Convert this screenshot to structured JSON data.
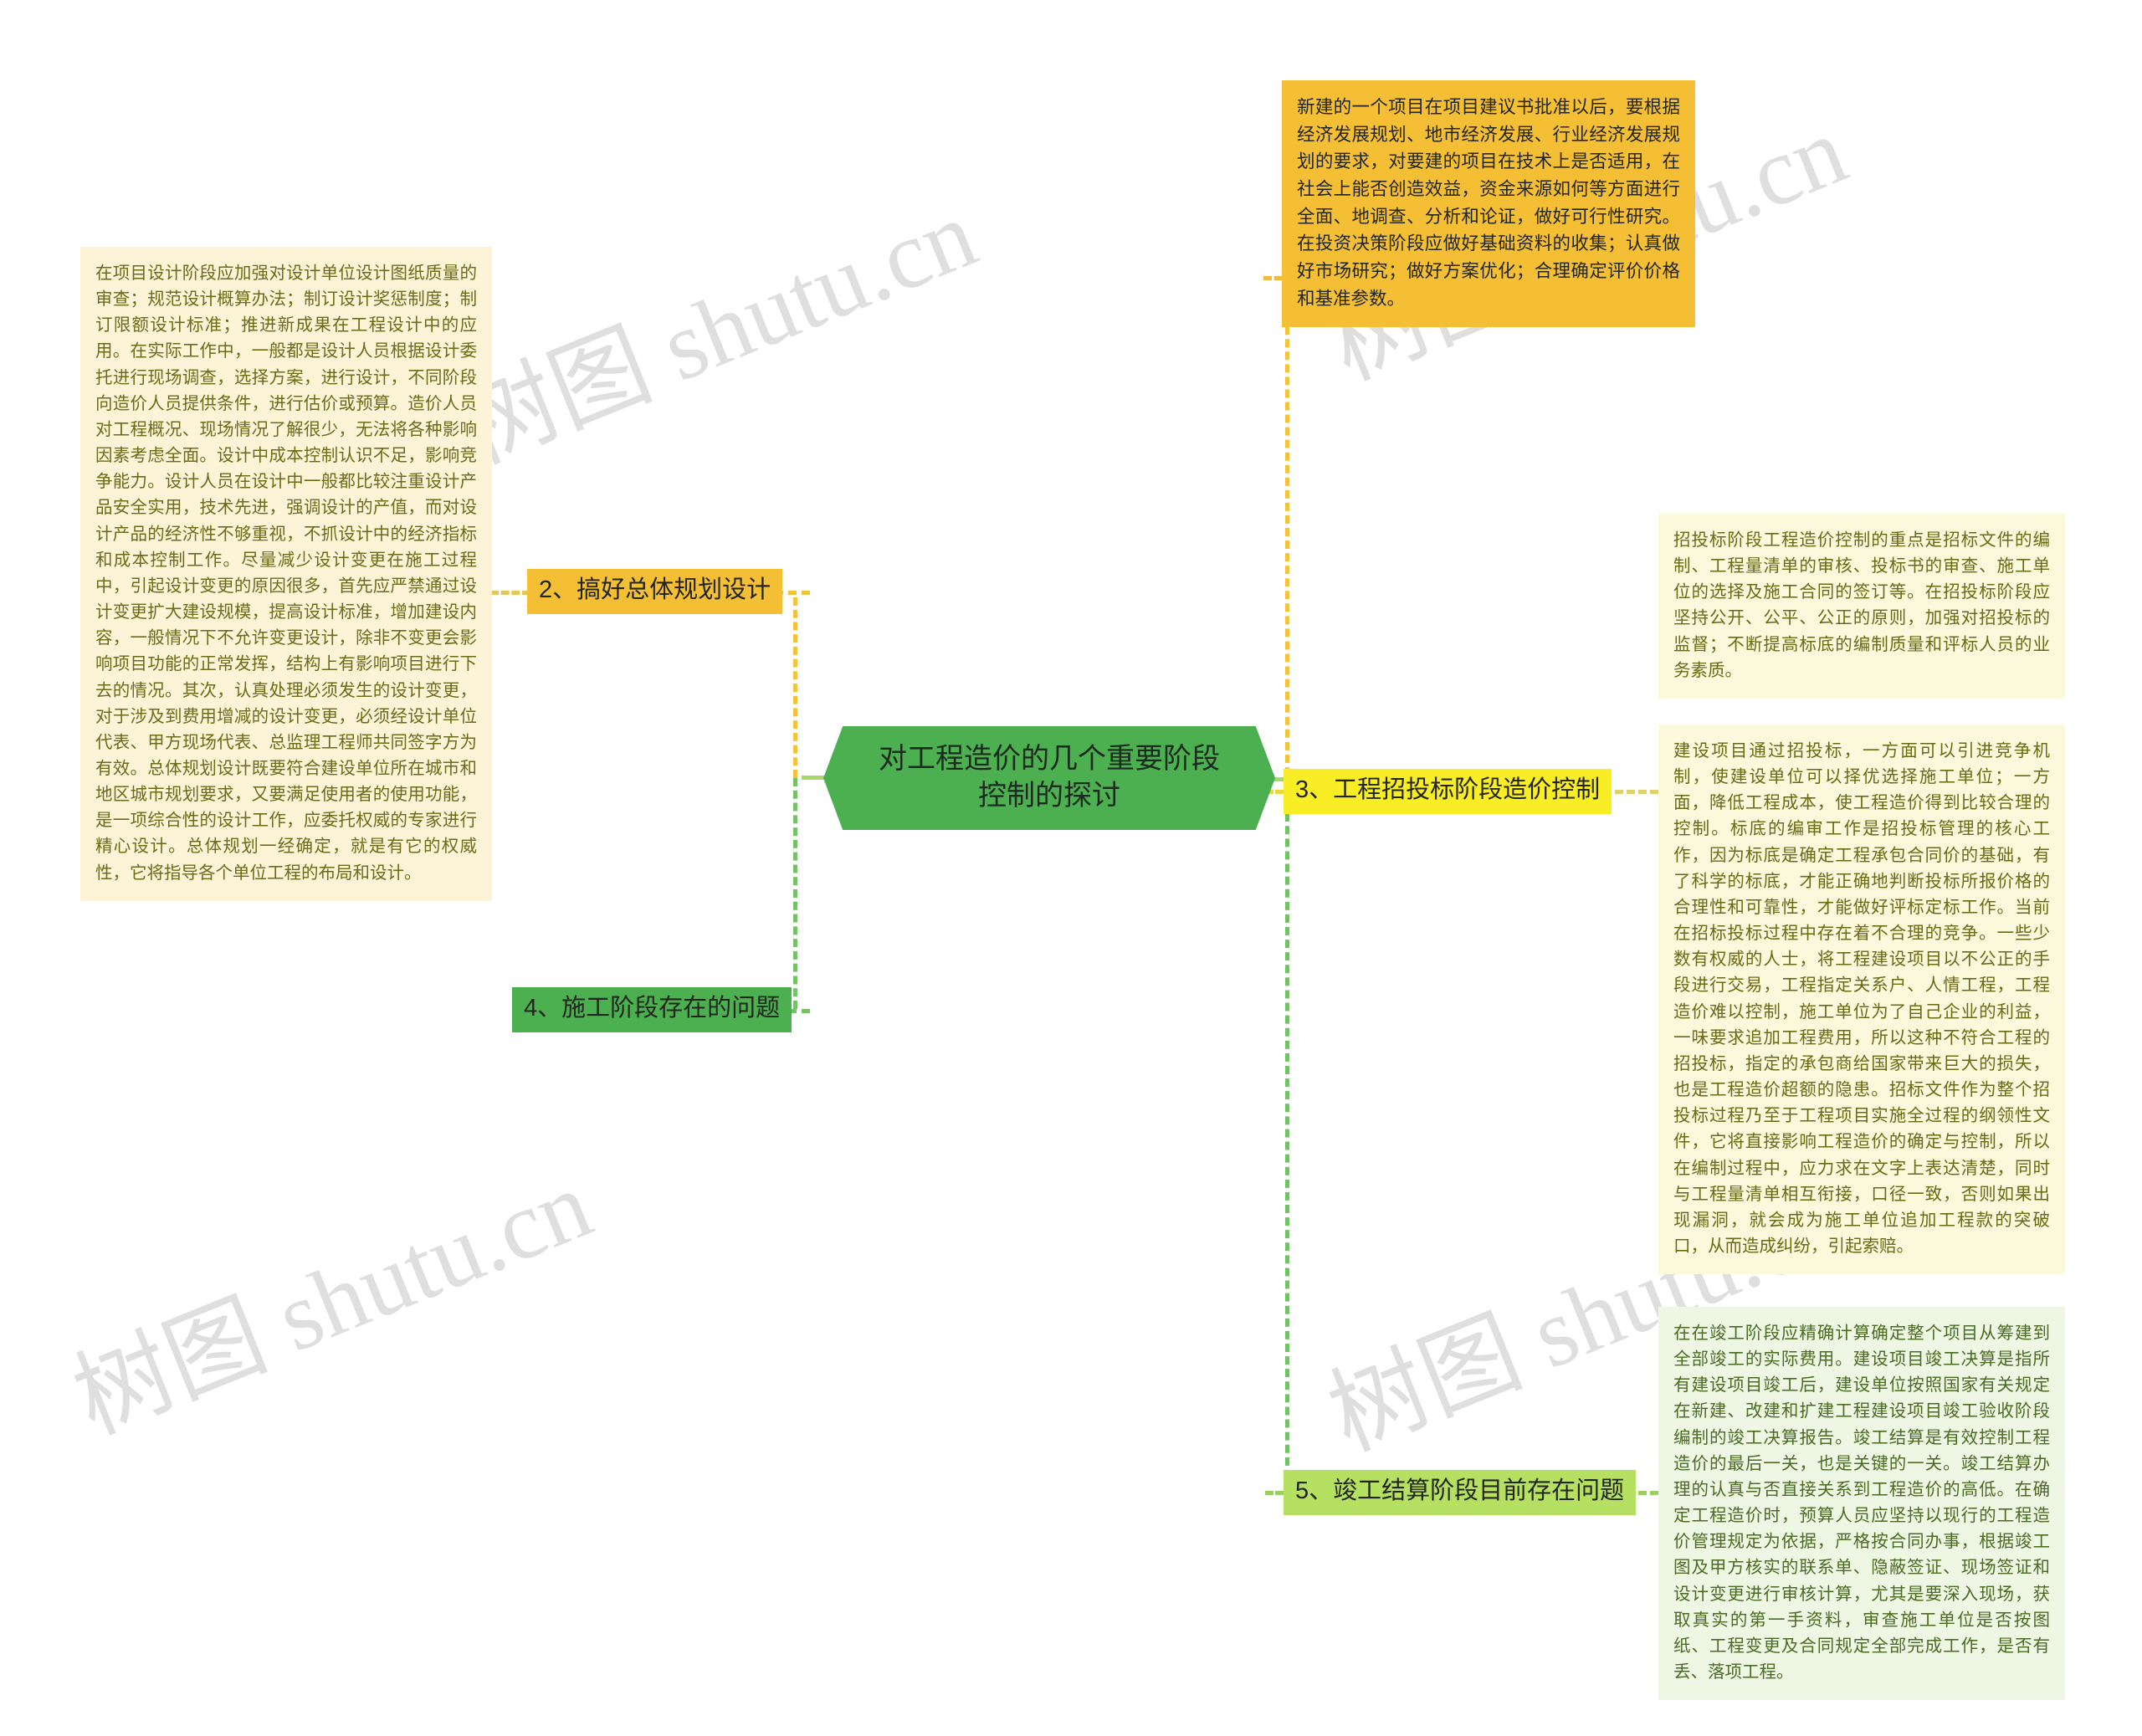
{
  "meta": {
    "watermark_text": "树图 shutu.cn",
    "colors": {
      "central": "#4caf50",
      "orange": "#f4bf34",
      "yellow": "#f9ed25",
      "green": "#4caf50",
      "light_green": "#b5e061",
      "cream": "#fdf4d8",
      "mint": "#eef7e4"
    }
  },
  "central": {
    "title": "对工程造价的几个重要阶段控制的探讨"
  },
  "branches": {
    "decision_detail": {
      "text": "新建的一个项目在项目建议书批准以后，要根据经济发展规划、地市经济发展、行业经济发展规划的要求，对要建的项目在技术上是否适用，在社会上能否创造效益，资金来源如何等方面进行全面、地调查、分析和论证，做好可行性研究。在投资决策阶段应做好基础资料的收集；认真做好市场研究；做好方案优化；合理确定评价价格和基准参数。"
    },
    "planning": {
      "label": "2、搞好总体规划设计",
      "detail": "在项目设计阶段应加强对设计单位设计图纸质量的审查；规范设计概算办法；制订设计奖惩制度；制订限额设计标准；推进新成果在工程设计中的应用。在实际工作中，一般都是设计人员根据设计委托进行现场调查，选择方案，进行设计，不同阶段向造价人员提供条件，进行估价或预算。造价人员对工程概况、现场情况了解很少，无法将各种影响因素考虑全面。设计中成本控制认识不足，影响竞争能力。设计人员在设计中一般都比较注重设计产品安全实用，技术先进，强调设计的产值，而对设计产品的经济性不够重视，不抓设计中的经济指标和成本控制工作。尽量减少设计变更在施工过程中，引起设计变更的原因很多，首先应严禁通过设计变更扩大建设规模，提高设计标准，增加建设内容，一般情况下不允许变更设计，除非不变更会影响项目功能的正常发挥，结构上有影响项目进行下去的情况。其次，认真处理必须发生的设计变更，对于涉及到费用增减的设计变更，必须经设计单位代表、甲方现场代表、总监理工程师共同签字方为有效。总体规划设计既要符合建设单位所在城市和地区城市规划要求，又要满足使用者的使用功能，是一项综合性的设计工作，应委托权威的专家进行精心设计。总体规划一经确定，就是有它的权威性，它将指导各个单位工程的布局和设计。"
    },
    "bidding": {
      "label": "3、工程招投标阶段造价控制",
      "detail_1": "招投标阶段工程造价控制的重点是招标文件的编制、工程量清单的审核、投标书的审查、施工单位的选择及施工合同的签订等。在招投标阶段应坚持公开、公平、公正的原则，加强对招投标的监督；不断提高标底的编制质量和评标人员的业务素质。",
      "detail_2": "建设项目通过招投标，一方面可以引进竞争机制，使建设单位可以择优选择施工单位；一方面，降低工程成本，使工程造价得到比较合理的控制。标底的编审工作是招投标管理的核心工作，因为标底是确定工程承包合同价的基础，有了科学的标底，才能正确地判断投标所报价格的合理性和可靠性，才能做好评标定标工作。当前在招标投标过程中存在着不合理的竞争。一些少数有权威的人士，将工程建设项目以不公正的手段进行交易，工程指定关系户、人情工程，工程造价难以控制，施工单位为了自己企业的利益，一味要求追加工程费用，所以这种不符合工程的招投标，指定的承包商给国家带来巨大的损失，也是工程造价超额的隐患。招标文件作为整个招投标过程乃至于工程项目实施全过程的纲领性文件，它将直接影响工程造价的确定与控制，所以在编制过程中，应力求在文字上表达清楚，同时与工程量清单相互衔接，口径一致，否则如果出现漏洞，就会成为施工单位追加工程款的突破口，从而造成纠纷，引起索赔。"
    },
    "construction": {
      "label": "4、施工阶段存在的问题"
    },
    "settlement": {
      "label": "5、竣工结算阶段目前存在问题",
      "detail": "在在竣工阶段应精确计算确定整个项目从筹建到全部竣工的实际费用。建设项目竣工决算是指所有建设项目竣工后，建设单位按照国家有关规定在新建、改建和扩建工程建设项目竣工验收阶段编制的竣工决算报告。竣工结算是有效控制工程造价的最后一关，也是关键的一关。竣工结算办理的认真与否直接关系到工程造价的高低。在确定工程造价时，预算人员应坚持以现行的工程造价管理规定为依据，严格按合同办事，根据竣工图及甲方核实的联系单、隐蔽签证、现场签证和设计变更进行审核计算，尤其是要深入现场，获取真实的第一手资料，审查施工单位是否按图纸、工程变更及合同规定全部完成工作，是否有丢、落项工程。"
    }
  }
}
